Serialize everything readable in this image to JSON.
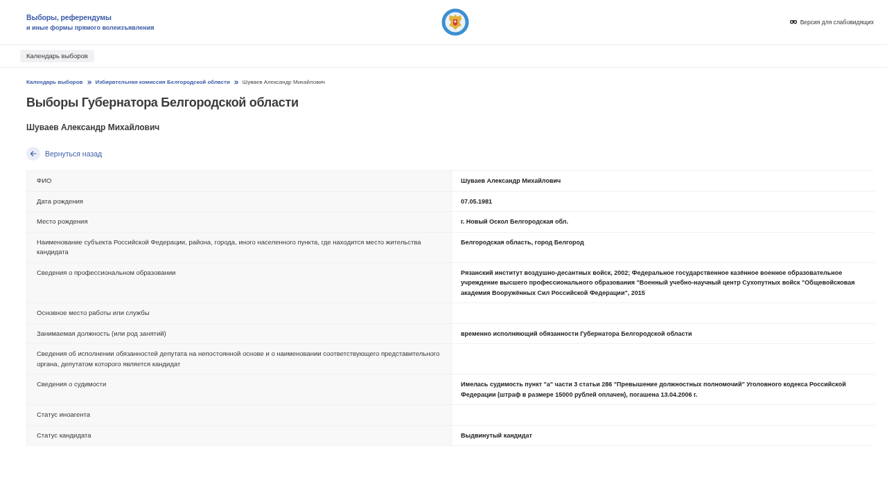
{
  "header": {
    "title_line_1": "Выборы, референдумы",
    "title_line_2": "и иные формы прямого волеизъявления",
    "accessibility_link": "Версия для слабовидящих"
  },
  "nav": {
    "items": [
      {
        "label": "Календарь выборов",
        "selected": true
      }
    ]
  },
  "breadcrumbs": [
    {
      "label": "Календарь выборов",
      "kind": "link"
    },
    {
      "label": "Избирательная комиссия Белгородской области",
      "kind": "link"
    },
    {
      "label": "Шуваев Александр Михайлович",
      "kind": "current"
    }
  ],
  "page_title": "Выборы Губернатора Белгородской области",
  "candidate_name": "Шуваев Александр Михайлович",
  "back_link": "Вернуться назад",
  "table": {
    "rows": [
      {
        "label": "ФИО",
        "value": "Шуваев Александр Михайлович"
      },
      {
        "label": "Дата рождения",
        "value": "07.05.1981"
      },
      {
        "label": "Место рождения",
        "value": "г. Новый Оскол Белгородская обл."
      },
      {
        "label": "Наименование субъекта Российской Федерации, района, города, иного населенного пункта, где находится место жительства кандидата",
        "value": "Белгородская область, город Белгород"
      },
      {
        "label": "Сведения о профессиональном образовании",
        "value": "Рязанский институт воздушно-десантных войск, 2002; Федеральное государственное казённое военное образовательное учреждение высшего профессионального образования \"Военный учебно-научный центр Сухопутных войск \"Общевойсковая академия Вооружённых Сил Российской Федерации\", 2015"
      },
      {
        "label": "Основное место работы или службы"
      },
      {
        "label": "Занимаемая должность (или род занятий)",
        "value": "временно исполняющий обязанности Губернатора Белгородской области"
      },
      {
        "label": "Сведения об исполнении обязанностей депутата на непостоянной основе и о наименовании соответствующего представительного органа, депутатом которого является кандидат"
      },
      {
        "label": "Сведения о судимости",
        "value": "Имелась судимость пункт \"а\" части 3 статьи 286 \"Превышение должностных полномочий\" Уголовного кодекса Российской Федерации (штраф в размере 15000 рублей оплачен), погашена 13.04.2006 г."
      },
      {
        "label": "Статус иноагента"
      },
      {
        "label": "Статус кандидата",
        "value": "Выдвинутый кандидат"
      }
    ]
  }
}
